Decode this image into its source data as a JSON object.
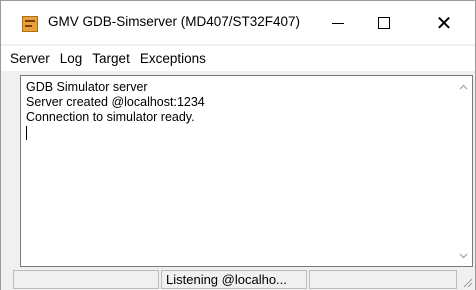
{
  "window": {
    "title": "GMV GDB-Simserver (MD407/ST32F407)",
    "icon": "app-icon"
  },
  "menubar": {
    "items": [
      {
        "label": "Server"
      },
      {
        "label": "Log"
      },
      {
        "label": "Target"
      },
      {
        "label": "Exceptions"
      }
    ]
  },
  "log": {
    "lines": [
      "GDB Simulator server",
      "Server created @localhost:1234",
      "Connection to simulator ready."
    ]
  },
  "statusbar": {
    "panes": [
      "",
      "Listening @localho...",
      ""
    ]
  },
  "colors": {
    "titlebar_bg": "#ffffff",
    "window_bg": "#f0f0f0",
    "icon_accent": "#e8a13a"
  }
}
